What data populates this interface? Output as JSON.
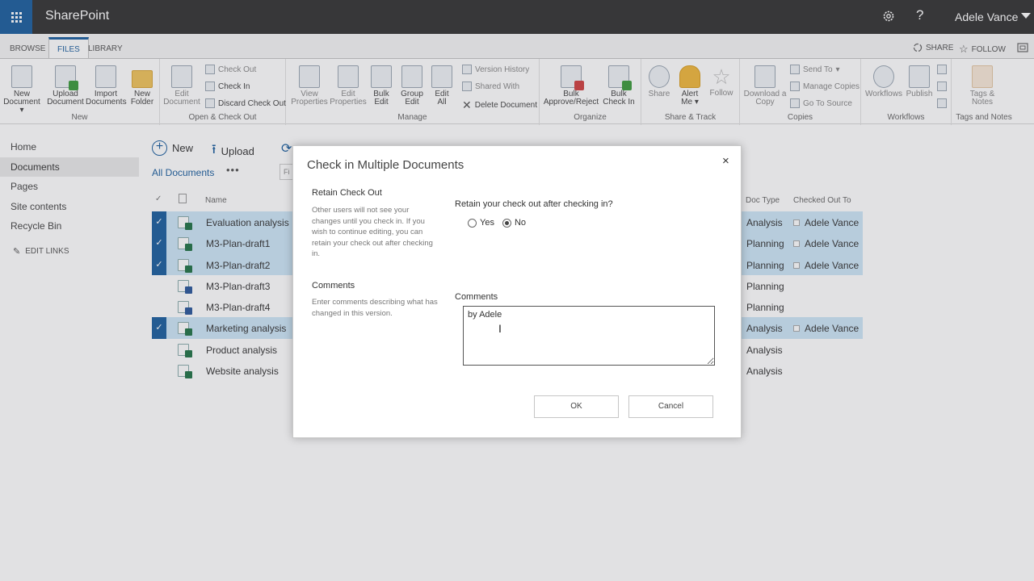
{
  "suite": {
    "app": "SharePoint",
    "user": "Adele Vance",
    "help_glyph": "?"
  },
  "ribbon": {
    "tabs": [
      "BROWSE",
      "FILES",
      "LIBRARY"
    ],
    "right": {
      "share": "SHARE",
      "follow": "FOLLOW"
    },
    "groups": {
      "new": {
        "label": "New",
        "new_document": "New Document",
        "upload_document": "Upload Document",
        "import_documents": "Import Documents",
        "new_folder": "New Folder"
      },
      "open": {
        "label": "Open & Check Out",
        "edit_document": "Edit Document",
        "check_out": "Check Out",
        "check_in": "Check In",
        "discard": "Discard Check Out"
      },
      "manage": {
        "label": "Manage",
        "view_properties": "View Properties",
        "edit_properties": "Edit Properties",
        "bulk_edit": "Bulk Edit",
        "group_edit": "Group Edit",
        "edit_all": "Edit All",
        "version_history": "Version History",
        "shared_with": "Shared With",
        "delete_document": "Delete Document"
      },
      "organize": {
        "label": "Organize",
        "bulk_approve": "Bulk Approve/Reject",
        "bulk_check_in": "Bulk Check In"
      },
      "share": {
        "label": "Share & Track",
        "share": "Share",
        "alert_me": "Alert Me",
        "follow": "Follow"
      },
      "copies": {
        "label": "Copies",
        "download_copy": "Download a Copy",
        "send_to": "Send To",
        "manage_copies": "Manage Copies",
        "go_to_source": "Go To Source"
      },
      "workflows": {
        "label": "Workflows",
        "workflows": "Workflows",
        "publish": "Publish"
      },
      "tags": {
        "label": "Tags and Notes",
        "tags_notes": "Tags & Notes"
      }
    }
  },
  "nav": {
    "items": [
      "Home",
      "Documents",
      "Pages",
      "Site contents",
      "Recycle Bin"
    ],
    "edit_links": "EDIT LINKS"
  },
  "commands": {
    "new": "New",
    "upload": "Upload",
    "find_stub": "Fi"
  },
  "view": {
    "title": "All Documents",
    "dots": "•••"
  },
  "columns": {
    "name": "Name",
    "doc_type": "Doc Type",
    "checked_out_to": "Checked Out To"
  },
  "rows": [
    {
      "name": "Evaluation analysis",
      "doc_type": "Analysis",
      "checked_out_to": "Adele Vance"
    },
    {
      "name": "M3-Plan-draft1",
      "doc_type": "Planning",
      "checked_out_to": "Adele Vance"
    },
    {
      "name": "M3-Plan-draft2",
      "doc_type": "Planning",
      "checked_out_to": "Adele Vance"
    },
    {
      "name": "M3-Plan-draft3",
      "doc_type": "Planning",
      "checked_out_to": ""
    },
    {
      "name": "M3-Plan-draft4",
      "doc_type": "Planning",
      "checked_out_to": ""
    },
    {
      "name": "Marketing analysis",
      "doc_type": "Analysis",
      "checked_out_to": "Adele Vance"
    },
    {
      "name": "Product analysis",
      "doc_type": "Analysis",
      "checked_out_to": ""
    },
    {
      "name": "Website analysis",
      "doc_type": "Analysis",
      "checked_out_to": ""
    }
  ],
  "dialog": {
    "title": "Check in Multiple Documents",
    "close": "×",
    "retain": {
      "title": "Retain Check Out",
      "desc": "Other users will not see your changes until you check in. If you wish to continue editing, you can retain your check out after checking in.",
      "question": "Retain your check out after checking in?",
      "yes": "Yes",
      "no": "No",
      "selected": "No"
    },
    "comments": {
      "title": "Comments",
      "desc": "Enter comments describing what has changed in this version.",
      "label": "Comments",
      "value": "by Adele"
    },
    "ok": "OK",
    "cancel": "Cancel"
  }
}
